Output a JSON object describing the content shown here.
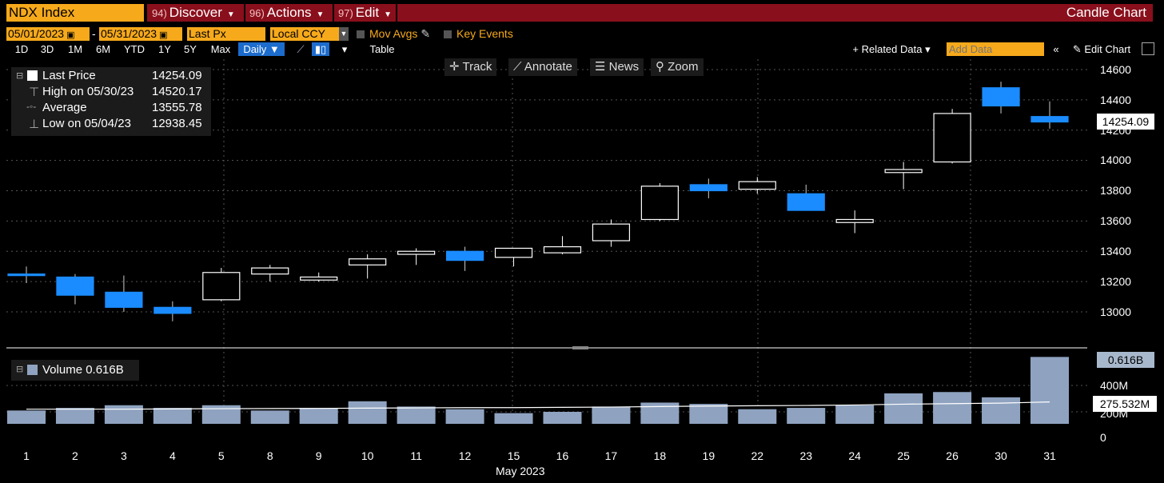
{
  "header": {
    "ticker": "NDX Index",
    "menus": [
      {
        "num": "94)",
        "label": "Discover"
      },
      {
        "num": "96)",
        "label": "Actions"
      },
      {
        "num": "97)",
        "label": "Edit"
      }
    ],
    "chart_type": "Candle Chart"
  },
  "controls": {
    "start_date": "05/01/2023",
    "end_date": "05/31/2023",
    "field": "Last Px",
    "currency": "Local CCY",
    "mov_avgs": "Mov Avgs",
    "key_events": "Key Events",
    "ranges": [
      "1D",
      "3D",
      "1M",
      "6M",
      "YTD",
      "1Y",
      "5Y",
      "Max"
    ],
    "period": "Daily ▼",
    "table": "Table",
    "related": "+ Related Data ▾",
    "add_data_placeholder": "Add Data",
    "edit_chart": "✎ Edit Chart",
    "tools": [
      "Track",
      "Annotate",
      "News",
      "Zoom"
    ]
  },
  "legend": {
    "items": [
      {
        "label": "Last Price",
        "value": "14254.09"
      },
      {
        "label": "High on 05/30/23",
        "value": "14520.17"
      },
      {
        "label": "Average",
        "value": "13555.78"
      },
      {
        "label": "Low on 05/04/23",
        "value": "12938.45"
      }
    ],
    "volume_label": "Volume 0.616B"
  },
  "axis": {
    "price_ticks": [
      "14600",
      "14400",
      "14200",
      "14000",
      "13800",
      "13600",
      "13400",
      "13200",
      "13000"
    ],
    "vol_ticks": [
      "400M",
      "200M",
      "0"
    ],
    "last_price_box": "14254.09",
    "volume_box": "0.616B",
    "vol_avg_box": "275.532M",
    "x_title": "May 2023"
  },
  "colors": {
    "up": "#000000",
    "down": "#1a8cff",
    "volume": "#8fa3c0",
    "accent": "#f6a91b",
    "header": "#8a0f1c"
  },
  "chart_data": {
    "type": "candlestick",
    "x": [
      "1",
      "2",
      "3",
      "4",
      "5",
      "8",
      "9",
      "10",
      "11",
      "12",
      "15",
      "16",
      "17",
      "18",
      "19",
      "22",
      "23",
      "24",
      "25",
      "26",
      "30",
      "31"
    ],
    "open": [
      13250,
      13230,
      13130,
      13030,
      13080,
      13250,
      13210,
      13310,
      13380,
      13400,
      13360,
      13390,
      13470,
      13610,
      13840,
      13810,
      13780,
      13590,
      13920,
      13990,
      14480,
      14290
    ],
    "high": [
      13300,
      13250,
      13240,
      13070,
      13290,
      13310,
      13260,
      13380,
      13420,
      13430,
      13420,
      13500,
      13610,
      13850,
      13880,
      13890,
      13840,
      13670,
      13990,
      14340,
      14520,
      14390
    ],
    "low": [
      13190,
      13050,
      13000,
      12938,
      13070,
      13200,
      13200,
      13220,
      13310,
      13270,
      13300,
      13380,
      13430,
      13600,
      13750,
      13780,
      13670,
      13520,
      13810,
      13980,
      14310,
      14210
    ],
    "close": [
      13240,
      13110,
      13030,
      12990,
      13260,
      13290,
      13230,
      13350,
      13400,
      13340,
      13420,
      13430,
      13580,
      13830,
      13800,
      13860,
      13670,
      13610,
      13940,
      14310,
      14360,
      14254
    ],
    "volume_m": [
      210,
      230,
      250,
      230,
      250,
      210,
      230,
      280,
      240,
      220,
      190,
      200,
      240,
      270,
      260,
      220,
      230,
      250,
      340,
      350,
      310,
      616
    ],
    "volume_avg_m": [
      220,
      220,
      220,
      222,
      224,
      225,
      226,
      228,
      230,
      232,
      232,
      234,
      236,
      240,
      244,
      246,
      248,
      252,
      258,
      262,
      266,
      275
    ]
  }
}
